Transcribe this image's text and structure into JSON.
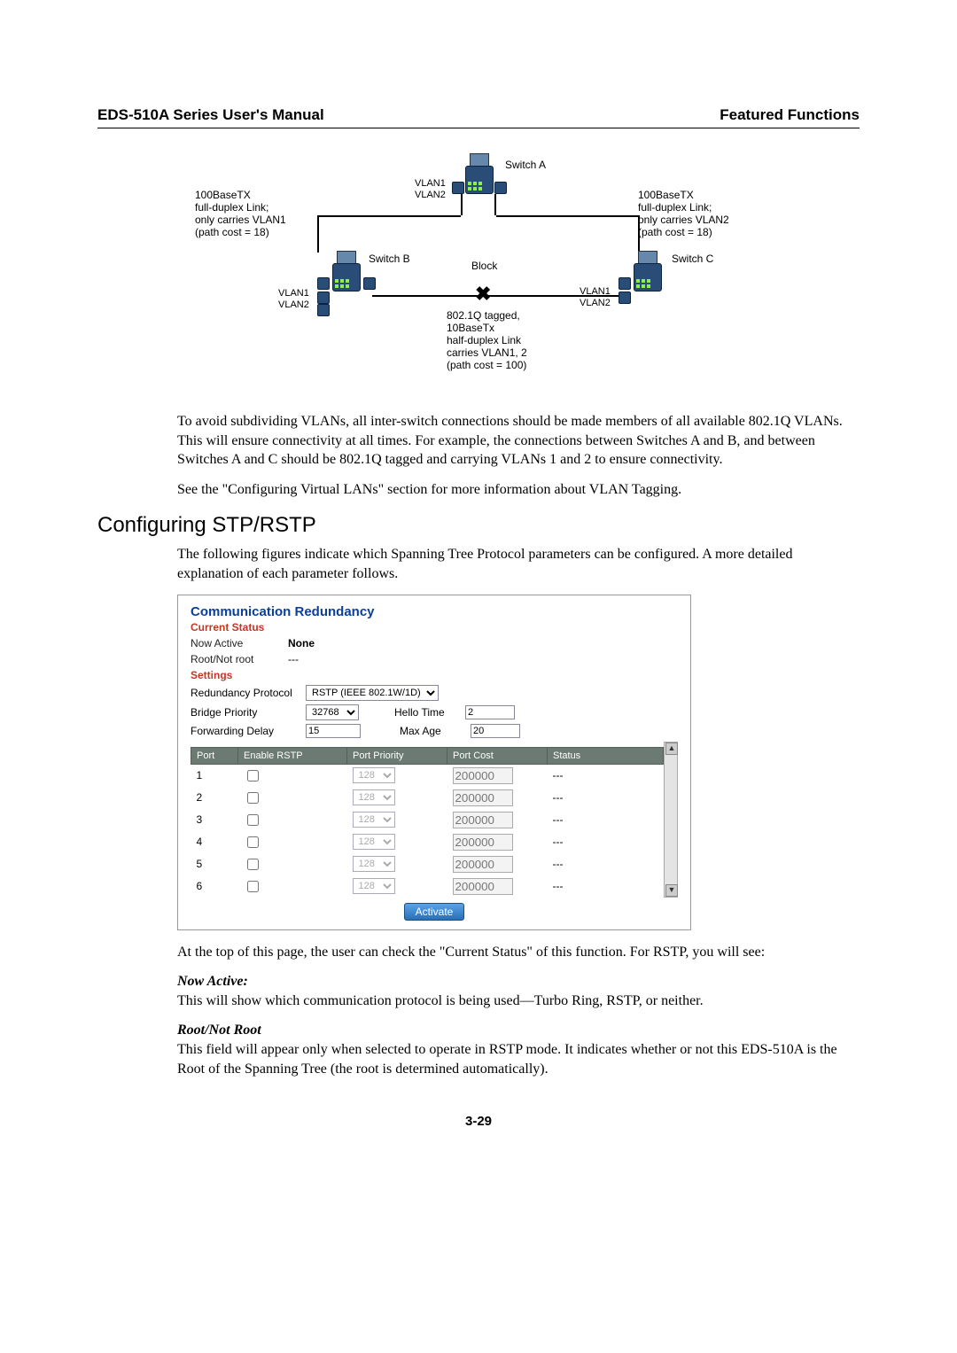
{
  "header": {
    "left": "EDS-510A Series User's Manual",
    "right": "Featured Functions"
  },
  "diagram": {
    "switchA": "Switch A",
    "switchB": "Switch B",
    "switchC": "Switch C",
    "block": "Block",
    "left_box": "100BaseTX\nfull-duplex Link;\nonly carries VLAN1\n(path cost = 18)",
    "right_box": "100BaseTX\nfull-duplex Link;\nonly carries VLAN2\n(path cost = 18)",
    "center_text": "802.1Q tagged,\n10BaseTx\nhalf-duplex Link\ncarries VLAN1, 2\n(path cost = 100)",
    "vlan1": "VLAN1",
    "vlan2": "VLAN2"
  },
  "para1": "To avoid subdividing VLANs, all inter-switch connections should be made members of all available 802.1Q VLANs. This will ensure connectivity at all times. For example, the connections between Switches A and B, and between Switches A and C should be 802.1Q tagged and carrying VLANs 1 and 2 to ensure connectivity.",
  "para2": "See the \"Configuring Virtual LANs\" section for more information about VLAN Tagging.",
  "h2": "Configuring STP/RSTP",
  "para3": "The following figures indicate which Spanning Tree Protocol parameters can be configured. A more detailed explanation of each parameter follows.",
  "panel": {
    "title": "Communication Redundancy",
    "current_status": "Current Status",
    "now_active_label": "Now Active",
    "now_active_value": "None",
    "root_label": "Root/Not root",
    "root_value": "---",
    "settings": "Settings",
    "redundancy_label": "Redundancy Protocol",
    "redundancy_value": "RSTP (IEEE 802.1W/1D)",
    "bridge_priority_label": "Bridge Priority",
    "bridge_priority_value": "32768",
    "hello_label": "Hello Time",
    "hello_value": "2",
    "fwd_label": "Forwarding Delay",
    "fwd_value": "15",
    "maxage_label": "Max Age",
    "maxage_value": "20",
    "cols": {
      "port": "Port",
      "enable": "Enable RSTP",
      "priority": "Port Priority",
      "cost": "Port Cost",
      "status": "Status"
    },
    "rows": [
      {
        "port": "1",
        "prio": "128",
        "cost": "200000",
        "status": "---"
      },
      {
        "port": "2",
        "prio": "128",
        "cost": "200000",
        "status": "---"
      },
      {
        "port": "3",
        "prio": "128",
        "cost": "200000",
        "status": "---"
      },
      {
        "port": "4",
        "prio": "128",
        "cost": "200000",
        "status": "---"
      },
      {
        "port": "5",
        "prio": "128",
        "cost": "200000",
        "status": "---"
      },
      {
        "port": "6",
        "prio": "128",
        "cost": "200000",
        "status": "---"
      }
    ],
    "activate": "Activate"
  },
  "para4": "At the top of this page, the user can check the \"Current Status\" of this function. For RSTP, you will see:",
  "now_active_heading": "Now Active:",
  "para5": "This will show which communication protocol is being used—Turbo Ring, RSTP, or neither.",
  "root_heading": "Root/Not Root",
  "para6": "This field will appear only when selected to operate in RSTP mode. It indicates whether or not this EDS-510A is the Root of the Spanning Tree (the root is determined automatically).",
  "page_number": "3-29"
}
